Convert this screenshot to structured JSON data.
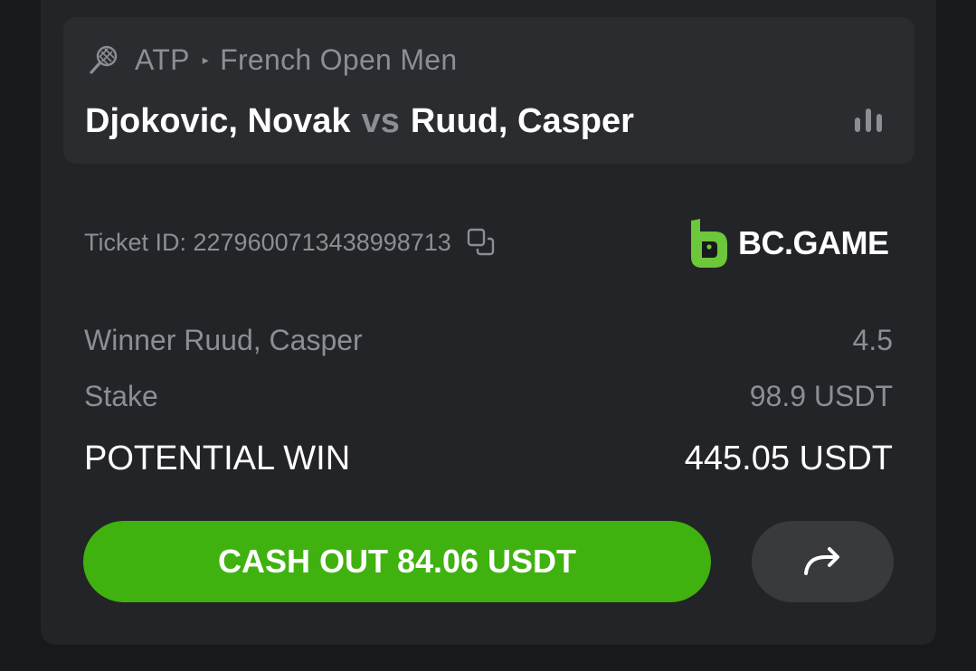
{
  "match": {
    "sport_icon": "tennis-racket-icon",
    "league": "ATP",
    "tournament": "French Open Men",
    "team_home": "Djokovic, Novak",
    "vs": "vs",
    "team_away": "Ruud, Casper",
    "stats_icon": "bar-chart-icon"
  },
  "ticket": {
    "id_label": "Ticket ID: 2279600713438998713",
    "copy_icon": "copy-icon"
  },
  "brand": {
    "name": "BC.GAME",
    "color": "#6cc73a"
  },
  "bet": {
    "selection": "Winner Ruud, Casper",
    "odds": "4.5",
    "stake_label": "Stake",
    "stake_value": "98.9 USDT",
    "potential_label": "POTENTIAL WIN",
    "potential_value": "445.05 USDT"
  },
  "actions": {
    "cashout_label": "CASH OUT 84.06 USDT",
    "cashout_color": "#3fb20f",
    "share_icon": "share-arrow-icon"
  }
}
